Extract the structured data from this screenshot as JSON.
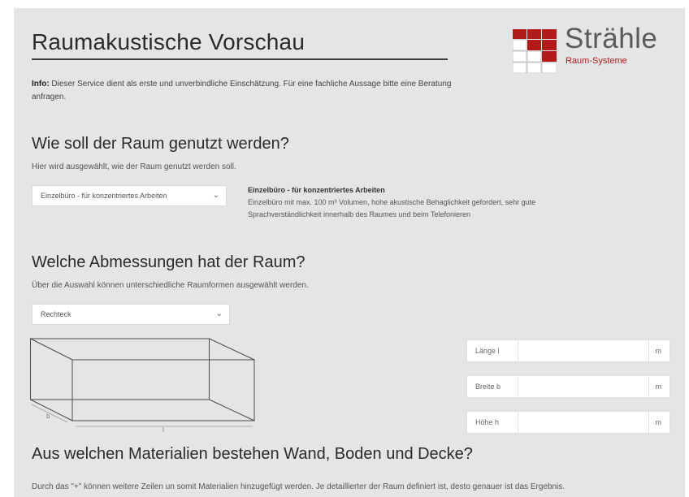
{
  "header": {
    "title": "Raumakustische Vorschau",
    "info_label": "Info:",
    "info_text": " Dieser Service dient als erste und unverbindliche Einschätzung. Für eine fachliche Aussage bitte eine Beratung anfragen."
  },
  "logo": {
    "wordmark": "Strähle",
    "subtitle": "Raum-Systeme",
    "accent_color": "#b31b1b"
  },
  "usage": {
    "heading": "Wie soll der Raum genutzt werden?",
    "description": "Hier wird ausgewählt, wie der Raum genutzt werden soll.",
    "select_value": "Einzelbüro - für konzentriertes Arbeiten",
    "info_title": "Einzelbüro - für konzentriertes Arbeiten",
    "info_text": "Einzelbüro mit max. 100 m³ Volumen, hohe akustische Behaglichkeit gefordert, sehr gute Sprachverständlichkeit innerhalb des Raumes und beim Telefonieren"
  },
  "dimensions": {
    "heading": "Welche Abmessungen hat der Raum?",
    "description": "Über die Auswahl können unterschiedliche Raumformen ausgewählt werden.",
    "shape_select": "Rechteck",
    "figure_label_l": "l",
    "figure_label_b": "b",
    "fields": [
      {
        "label": "Länge l",
        "value": "",
        "unit": "m"
      },
      {
        "label": "Breite b",
        "value": "",
        "unit": "m"
      },
      {
        "label": "Höhe h",
        "value": "",
        "unit": "m"
      }
    ]
  },
  "materials": {
    "heading": "Aus welchen Materialien bestehen Wand, Boden und Decke?",
    "description": "Durch das \"+\" können weitere Zeilen un somit Materialien hinzugefügt werden. Je detaillierter der Raum definiert ist, desto genauer ist das Ergebnis."
  },
  "icons": {
    "dropdown": "chevron-down-icon"
  }
}
